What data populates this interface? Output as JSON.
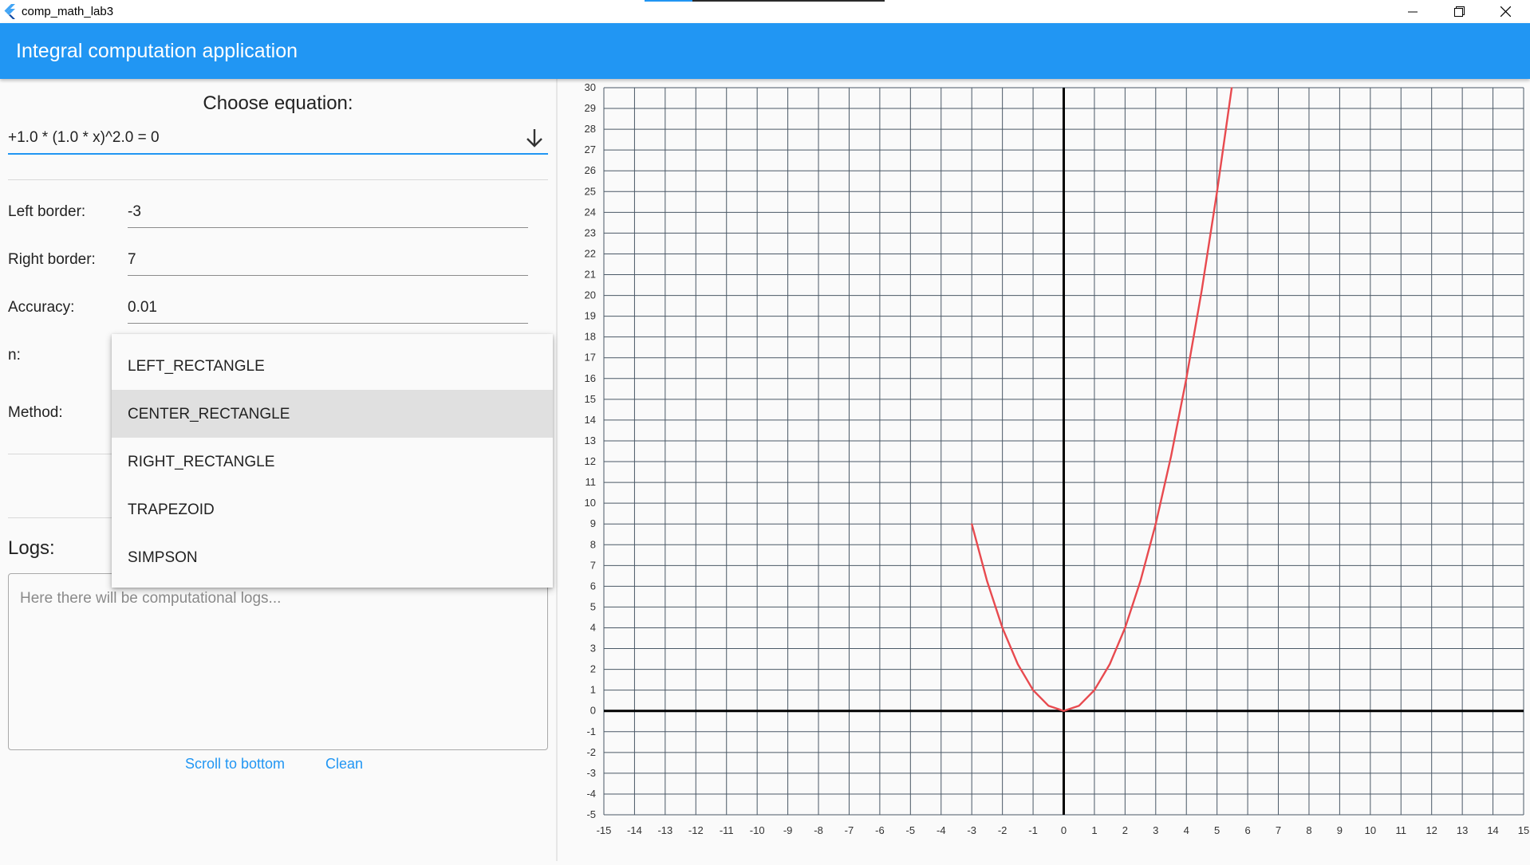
{
  "window": {
    "title": "comp_math_lab3",
    "title_progress": 0.2
  },
  "appbar": {
    "title": "Integral computation application"
  },
  "equation": {
    "label": "Choose equation:",
    "selected": "+1.0 * (1.0 * x)^2.0 = 0"
  },
  "fields": {
    "left_border": {
      "label": "Left border:",
      "value": "-3"
    },
    "right_border": {
      "label": "Right border:",
      "value": "7"
    },
    "accuracy": {
      "label": "Accuracy:",
      "value": "0.01"
    },
    "n": {
      "label": "n:"
    },
    "method": {
      "label": "Method:"
    }
  },
  "method_menu": {
    "options": [
      "LEFT_RECTANGLE",
      "CENTER_RECTANGLE",
      "RIGHT_RECTANGLE",
      "TRAPEZOID",
      "SIMPSON"
    ],
    "highlighted": "CENTER_RECTANGLE"
  },
  "logs": {
    "label": "Logs:",
    "placeholder": "Here there will be computational logs...",
    "scroll_button": "Scroll to bottom",
    "clean_button": "Clean"
  },
  "colors": {
    "primary": "#2196f3",
    "curve": "#e84a4f",
    "grid": "#4a5866",
    "axis": "#000000"
  },
  "chart_data": {
    "type": "line",
    "xlim": [
      -15,
      15
    ],
    "ylim": [
      -5,
      30
    ],
    "x_ticks": [
      -15,
      -14,
      -13,
      -12,
      -11,
      -10,
      -9,
      -8,
      -7,
      -6,
      -5,
      -4,
      -3,
      -2,
      -1,
      0,
      1,
      2,
      3,
      4,
      5,
      6,
      7,
      8,
      9,
      10,
      11,
      12,
      13,
      14,
      15
    ],
    "y_ticks": [
      -5,
      -4,
      -3,
      -2,
      -1,
      0,
      1,
      2,
      3,
      4,
      5,
      6,
      7,
      8,
      9,
      10,
      11,
      12,
      13,
      14,
      15,
      16,
      17,
      18,
      19,
      20,
      21,
      22,
      23,
      24,
      25,
      26,
      27,
      28,
      29,
      30
    ],
    "grid": true,
    "series": [
      {
        "function": "x^2",
        "x": [
          -3,
          -2.5,
          -2,
          -1.5,
          -1,
          -0.5,
          0,
          0.5,
          1,
          1.5,
          2,
          2.5,
          3,
          3.5,
          4,
          4.5,
          5,
          5.48
        ],
        "y": [
          9,
          6.25,
          4,
          2.25,
          1,
          0.25,
          0,
          0.25,
          1,
          2.25,
          4,
          6.25,
          9,
          12.25,
          16,
          20.25,
          25,
          30
        ]
      }
    ]
  }
}
